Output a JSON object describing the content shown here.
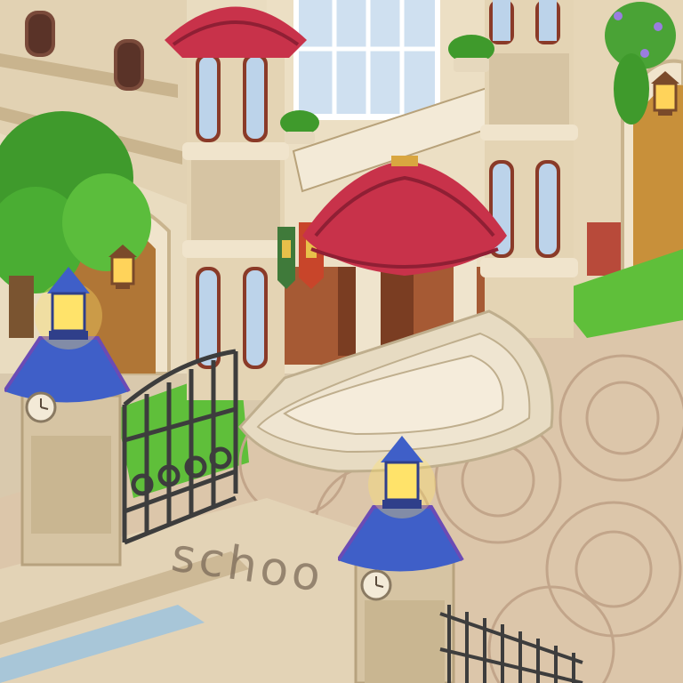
{
  "scene": {
    "ground_text": "schoo"
  },
  "colors": {
    "wall_cream": "#e9dcc0",
    "stone": "#d6c4a3",
    "roof_red": "#c8324a",
    "roof_red_dark": "#8f1f34",
    "pillar_roof_blue": "#3f5fc8",
    "pillar_roof_purple": "#6b4bb5",
    "lamp_glow": "#ffe36a",
    "grass": "#5fbf3a",
    "tree_green": "#3f9a2c",
    "window_blue": "#bcd3ea",
    "wood_door": "#8a4a2a",
    "iron": "#3d3d3d",
    "cobble": "#d8c3a8",
    "cobble_dark": "#c2a58a",
    "text_engraved": "#7b6a58"
  },
  "icons": {
    "clock_left": "clock-icon",
    "clock_right": "clock-icon",
    "lamp_left": "lantern-icon",
    "lamp_right": "lantern-icon",
    "wall_lamp": "wall-lantern-icon",
    "banner_left": "heraldic-banner-icon",
    "banner_right": "heraldic-banner-icon"
  }
}
